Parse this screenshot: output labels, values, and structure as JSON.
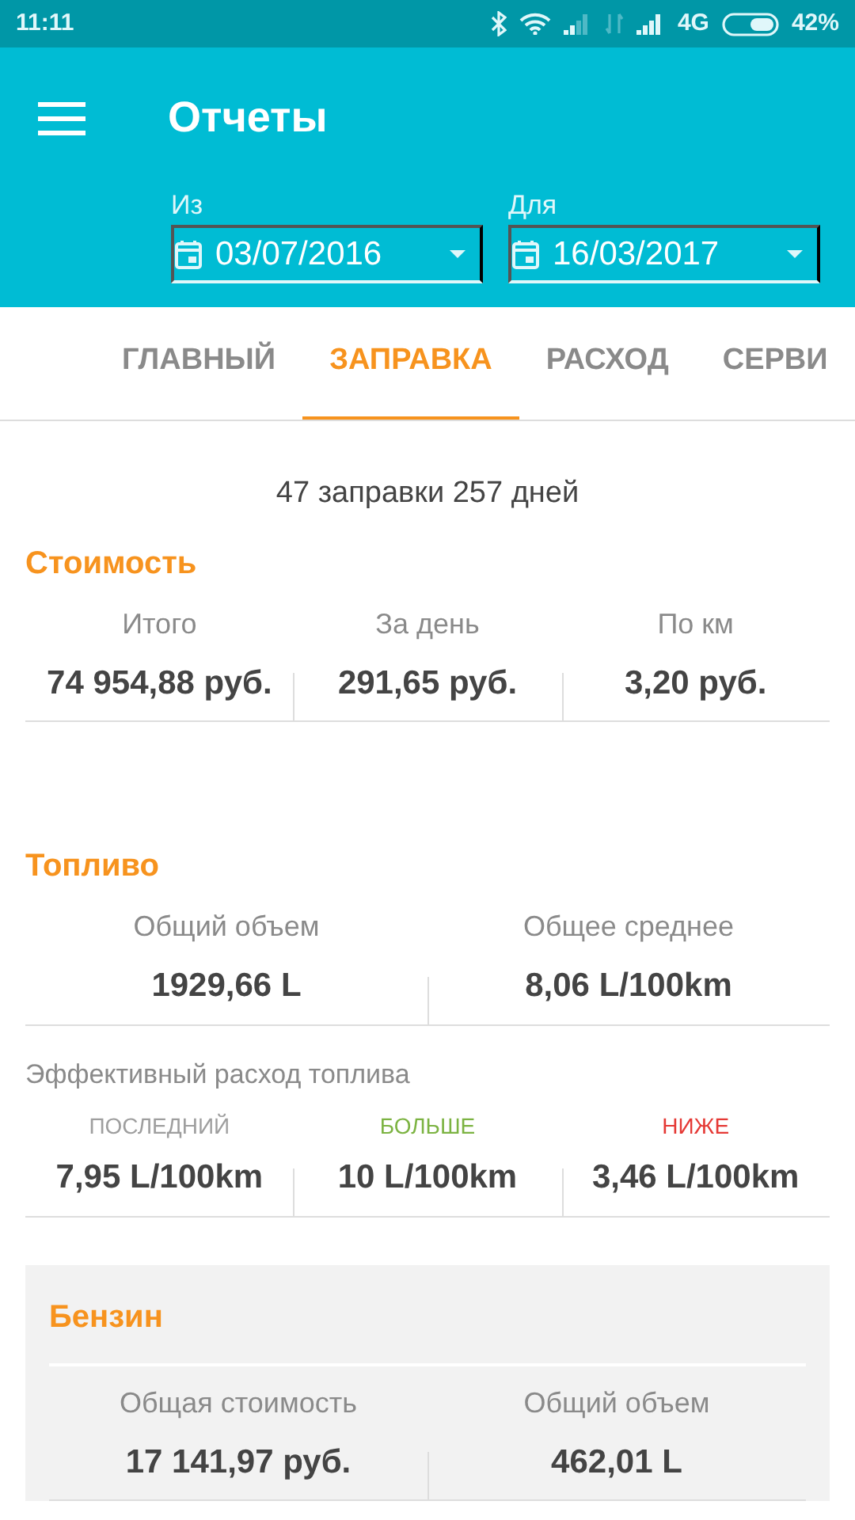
{
  "status_bar": {
    "time": "11:11",
    "network": "4G",
    "battery": "42%"
  },
  "app_bar": {
    "title": "Отчеты",
    "date_from": {
      "label": "Из",
      "value": "03/07/2016"
    },
    "date_to": {
      "label": "Для",
      "value": "16/03/2017"
    }
  },
  "tabs": [
    {
      "label": "ГЛАВНЫЙ",
      "selected": false
    },
    {
      "label": "ЗАПРАВКА",
      "selected": true
    },
    {
      "label": "РАСХОД",
      "selected": false
    },
    {
      "label": "СЕРВИ",
      "selected": false
    }
  ],
  "summary": "47 заправки 257 дней",
  "sections": [
    {
      "kind": "plain",
      "title": "Стоимость",
      "groups": [
        {
          "stats": [
            {
              "label": "Итого",
              "value": "74 954,88 руб."
            },
            {
              "label": "За день",
              "value": "291,65 руб."
            },
            {
              "label": "По км",
              "value": "3,20 руб."
            }
          ]
        }
      ]
    },
    {
      "kind": "plain",
      "title": "Топливо",
      "groups": [
        {
          "stats": [
            {
              "label": "Общий объем",
              "value": "1929,66 L"
            },
            {
              "label": "Общее среднее",
              "value": "8,06 L/100km"
            }
          ]
        },
        {
          "subtitle": "Эффективный расход топлива",
          "stats": [
            {
              "label": "ПОСЛЕДНИЙ",
              "color": "#9e9e9e",
              "value": "7,95 L/100km"
            },
            {
              "label": "БОЛЬШЕ",
              "color": "#7cb342",
              "value": "10 L/100km"
            },
            {
              "label": "НИЖЕ",
              "color": "#e53935",
              "value": "3,46 L/100km"
            }
          ]
        }
      ]
    },
    {
      "kind": "card",
      "title": "Бензин",
      "groups": [
        {
          "stats": [
            {
              "label": "Общая стоимость",
              "value": "17 141,97 руб."
            },
            {
              "label": "Общий объем",
              "value": "462,01 L"
            }
          ]
        }
      ]
    }
  ]
}
